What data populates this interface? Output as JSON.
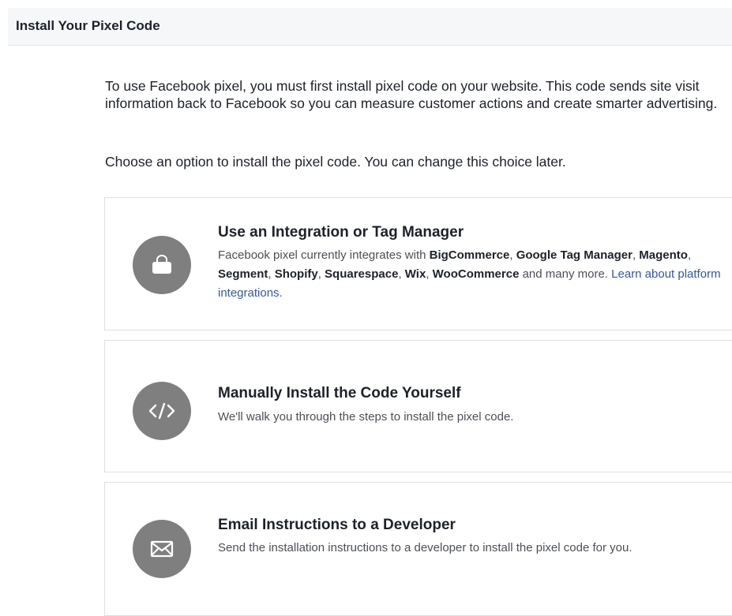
{
  "header": {
    "title": "Install Your Pixel Code"
  },
  "intro": "To use Facebook pixel, you must first install pixel code on your website. This code sends site visit information back to Facebook so you can measure customer actions and create smarter advertising.",
  "choose": "Choose an option to install the pixel code. You can change this choice later.",
  "options": [
    {
      "title": "Use an Integration or Tag Manager",
      "icon": "shopping-bag-icon",
      "desc": {
        "prefix": "Facebook pixel currently integrates with ",
        "partners": [
          "BigCommerce",
          "Google Tag Manager",
          "Magento",
          "Segment",
          "Shopify",
          "Squarespace",
          "Wix",
          "WooCommerce"
        ],
        "sep": ", ",
        "suffix": " and many more. ",
        "link": "Learn about platform integrations."
      }
    },
    {
      "title": "Manually Install the Code Yourself",
      "icon": "code-icon",
      "desc": "We'll walk you through the steps to install the pixel code."
    },
    {
      "title": "Email Instructions to a Developer",
      "icon": "envelope-icon",
      "desc": "Send the installation instructions to a developer to install the pixel code for you."
    }
  ],
  "colors": {
    "icon_bg": "#7f7f7f",
    "link": "#365899",
    "header_bg": "#f6f7f9"
  }
}
